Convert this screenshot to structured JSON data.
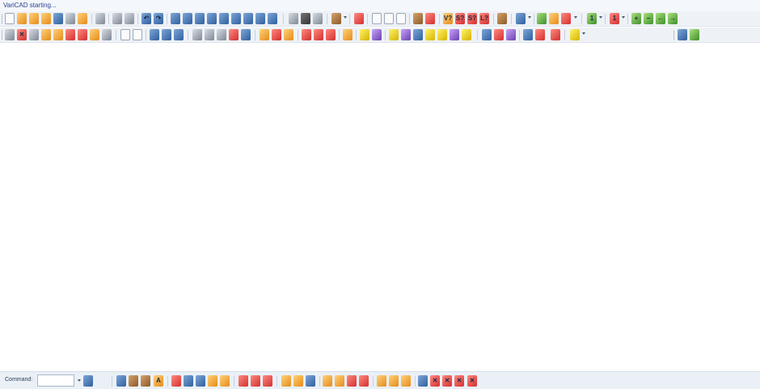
{
  "window": {
    "status_title": "VariCAD starting..."
  },
  "statusbar": {
    "command_label": "Command:",
    "command_value": ""
  },
  "toolbar1": {
    "icons": [
      "new-icon",
      "open-icon",
      "open-folder-icon",
      "save-icon",
      "save-as-icon",
      "batch-save-icon",
      "export-icon",
      "print-icon",
      "copy-icon",
      "paste-icon",
      "undo-icon",
      "redo-icon",
      "box-icon",
      "cylinder-icon",
      "cone-icon",
      "pyramid-icon",
      "prism-icon",
      "sphere-icon",
      "torus-icon",
      "rotate-solid-icon",
      "sweep-icon",
      "joint-icon",
      "camera-icon",
      "layers-icon",
      "material-icon",
      "help-icon",
      "query-icon",
      "measure-icon",
      "zoom-in-icon",
      "zoom-out-icon",
      "zoom-prev-icon",
      "zoom-next-icon"
    ]
  },
  "toolbar2": {
    "icons": [
      "snap-icon",
      "delete-icon",
      "move-icon",
      "array-icon",
      "mirror-icon",
      "rotate-icon",
      "scale-icon",
      "trim-icon",
      "extend-icon",
      "fillet-icon",
      "chamfer-icon",
      "boolean-add-icon",
      "boolean-subtract-icon",
      "intersect-icon",
      "section-icon",
      "dimension-icon",
      "hatch-icon",
      "text-icon",
      "layer-icon",
      "insert-icon",
      "attach-icon",
      "detach-icon",
      "hide-icon",
      "show-icon",
      "grid-icon",
      "ortho-icon",
      "snap-toggle-icon",
      "view-front-icon",
      "view-top-icon"
    ]
  },
  "statusbar_tools": {
    "icons": [
      "solid-icon",
      "surface-icon",
      "pipe-icon",
      "text-style-icon",
      "block-icon",
      "bom-icon",
      "attribute-icon",
      "hatch-fill-icon",
      "color-icon",
      "layer-red-icon",
      "layer-list-icon",
      "layer-set-icon",
      "open-folder-small-icon",
      "tree-icon",
      "orbit-icon",
      "select-all-icon",
      "select-window-icon",
      "select-cross-icon",
      "select-remove-icon",
      "group-icon",
      "ungroup-icon",
      "filter-icon",
      "redraw-icon",
      "close-1-icon",
      "close-2-icon",
      "close-3-icon",
      "close-4-icon"
    ]
  }
}
